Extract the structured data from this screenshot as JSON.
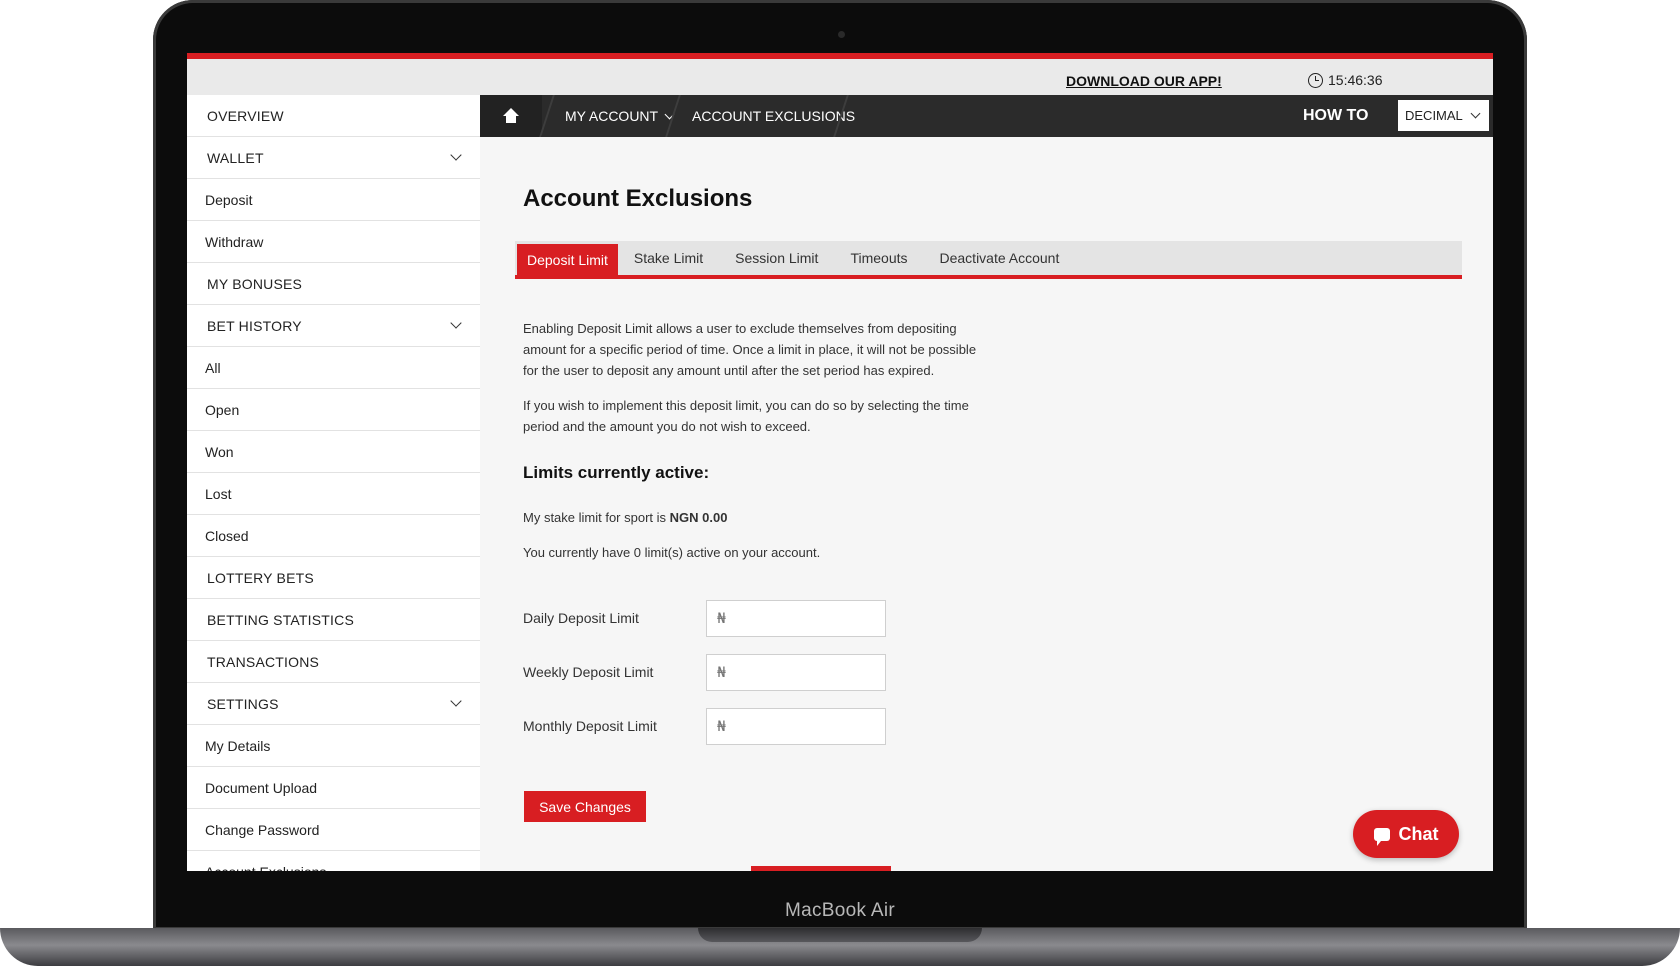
{
  "device": {
    "label": "MacBook Air"
  },
  "topbar": {
    "download_label": "DOWNLOAD OUR APP!",
    "clock_icon": "clock-icon",
    "time": "15:46:36"
  },
  "sidebar": {
    "items": [
      {
        "label": "OVERVIEW",
        "kind": "section",
        "expandable": false
      },
      {
        "label": "WALLET",
        "kind": "section",
        "expandable": true
      },
      {
        "label": "Deposit",
        "kind": "sub"
      },
      {
        "label": "Withdraw",
        "kind": "sub"
      },
      {
        "label": "MY BONUSES",
        "kind": "section",
        "expandable": false
      },
      {
        "label": "BET HISTORY",
        "kind": "section",
        "expandable": true
      },
      {
        "label": "All",
        "kind": "sub"
      },
      {
        "label": "Open",
        "kind": "sub"
      },
      {
        "label": "Won",
        "kind": "sub"
      },
      {
        "label": "Lost",
        "kind": "sub"
      },
      {
        "label": "Closed",
        "kind": "sub"
      },
      {
        "label": "LOTTERY BETS",
        "kind": "section",
        "expandable": false
      },
      {
        "label": "BETTING STATISTICS",
        "kind": "section",
        "expandable": false
      },
      {
        "label": "TRANSACTIONS",
        "kind": "section",
        "expandable": false
      },
      {
        "label": "SETTINGS",
        "kind": "section",
        "expandable": true
      },
      {
        "label": "My Details",
        "kind": "sub"
      },
      {
        "label": "Document Upload",
        "kind": "sub"
      },
      {
        "label": "Change Password",
        "kind": "sub"
      },
      {
        "label": "Account Exclusions",
        "kind": "sub"
      }
    ]
  },
  "navbar": {
    "home_icon": "home-icon",
    "crumb_account": "MY ACCOUNT",
    "crumb_current": "ACCOUNT EXCLUSIONS",
    "howto_label": "HOW TO",
    "odds_format": "DECIMAL"
  },
  "main": {
    "title": "Account Exclusions",
    "tabs": [
      {
        "label": "Deposit Limit",
        "active": true
      },
      {
        "label": "Stake Limit",
        "active": false
      },
      {
        "label": "Session Limit",
        "active": false
      },
      {
        "label": "Timeouts",
        "active": false
      },
      {
        "label": "Deactivate Account",
        "active": false
      }
    ],
    "paragraph_1": "Enabling Deposit Limit allows a user to exclude themselves from depositing amount for a specific period of time. Once a limit in place, it will not be possible for the user to deposit any amount until after the set period has expired.",
    "paragraph_2": "If you wish to implement this deposit limit, you can do so by selecting the time period and the amount you do not wish to exceed.",
    "limits_heading": "Limits currently active:",
    "stake_line_prefix": "My stake limit for sport is ",
    "stake_line_value": "NGN 0.00",
    "active_count_line": "You currently have 0 limit(s) active on your account.",
    "fields": [
      {
        "label": "Daily Deposit Limit",
        "currency": "₦",
        "value": ""
      },
      {
        "label": "Weekly Deposit Limit",
        "currency": "₦",
        "value": ""
      },
      {
        "label": "Monthly Deposit Limit",
        "currency": "₦",
        "value": ""
      }
    ],
    "save_label": "Save Changes",
    "chat_label": "Chat",
    "chat_icon": "chat-bubble-icon"
  },
  "colors": {
    "accent": "#d81e22",
    "navbar": "#2b2b2b",
    "sidebar_bg": "#ffffff",
    "content_bg": "#f6f6f6"
  }
}
